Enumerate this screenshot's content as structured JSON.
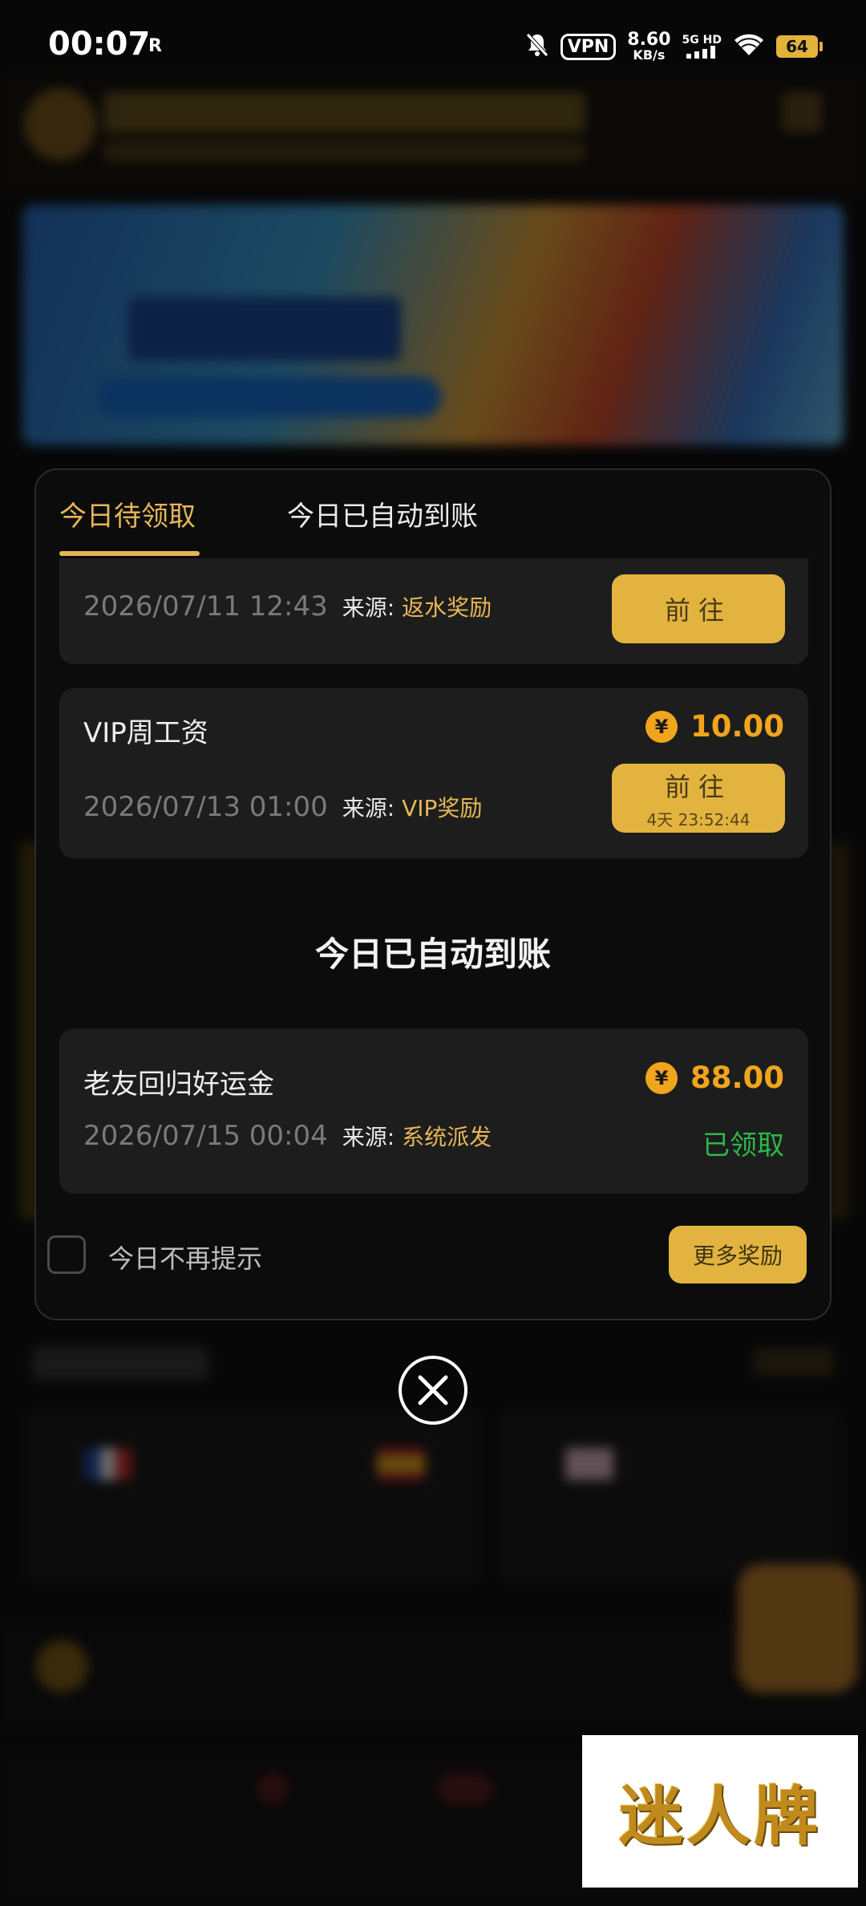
{
  "status_bar": {
    "time": "00:07",
    "indicator": "R",
    "vpn": "VPN",
    "speed_value": "8.60",
    "speed_unit": "KB/s",
    "network": "5G HD",
    "battery": "64",
    "icons": [
      "bell-muted-icon",
      "signal-icon",
      "wifi-icon",
      "battery-icon"
    ]
  },
  "modal": {
    "tabs": [
      {
        "label": "今日待领取",
        "active": true
      },
      {
        "label": "今日已自动到账",
        "active": false
      }
    ],
    "pending_items": [
      {
        "datetime": "2026/07/11 12:43",
        "source_label": "来源:",
        "source": "返水奖励",
        "button": "前往"
      },
      {
        "title": "VIP周工资",
        "amount": "10.00",
        "currency_symbol": "¥",
        "datetime": "2026/07/13 01:00",
        "source_label": "来源:",
        "source": "VIP奖励",
        "button": "前往",
        "countdown": "4天 23:52:44"
      }
    ],
    "auto_section_title": "今日已自动到账",
    "auto_items": [
      {
        "title": "老友回归好运金",
        "amount": "88.00",
        "currency_symbol": "¥",
        "datetime": "2026/07/15 00:04",
        "source_label": "来源:",
        "source": "系统派发",
        "status": "已领取"
      }
    ],
    "dont_show_today": "今日不再提示",
    "more_rewards": "更多奖励"
  },
  "watermark": "迷人牌",
  "colors": {
    "accent_gold": "#e6b657",
    "button_gold": "#e2b43f",
    "amount_orange": "#f0a51c",
    "claimed_green": "#2db84a",
    "card_bg": "#1d1d1d"
  }
}
